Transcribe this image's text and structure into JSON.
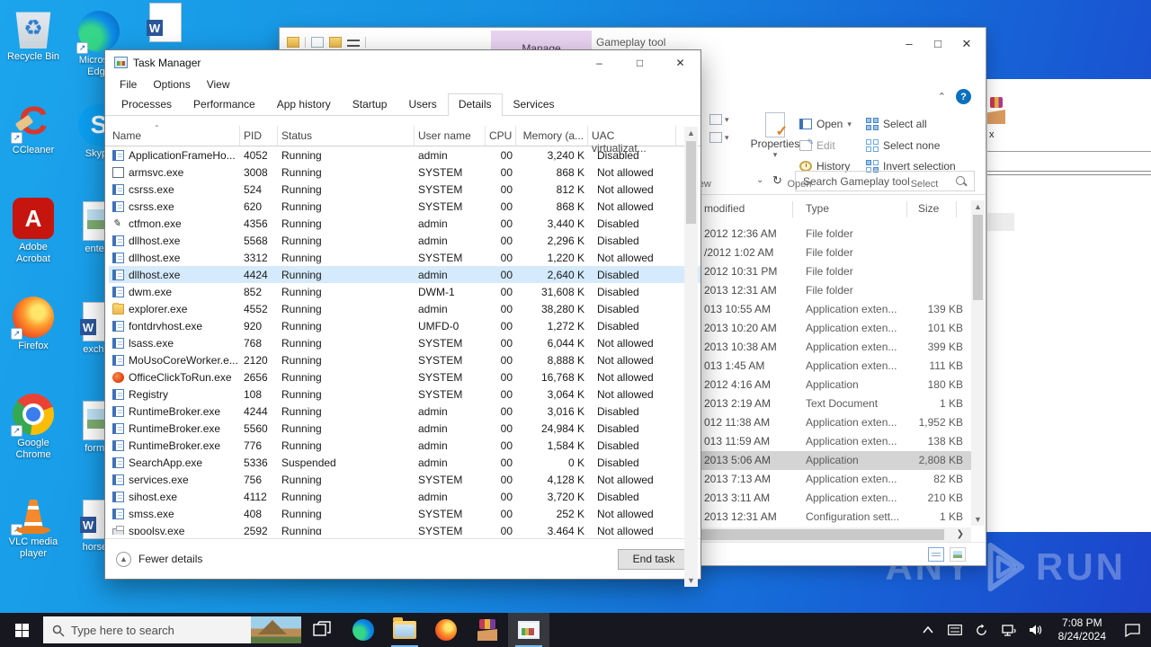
{
  "colors": {
    "desktop_top": "#1ba5ec",
    "desktop_bottom": "#1c43cb",
    "taskbar": "#17171f",
    "tm_selected_row": "#d5eafc",
    "fx_selected_row": "#d4d4d4",
    "manage_tab": "#e9d3f2",
    "help_blue": "#0b6fbd"
  },
  "desktop": {
    "col1": [
      {
        "label": "Recycle Bin",
        "icon": "recycle",
        "shortcut": false
      },
      {
        "label": "CCleaner",
        "icon": "ccleaner",
        "shortcut": true
      },
      {
        "label": "Adobe Acrobat",
        "icon": "acrobat",
        "shortcut": true
      },
      {
        "label": "Firefox",
        "icon": "firefox",
        "shortcut": true
      },
      {
        "label": "Google Chrome",
        "icon": "chrome",
        "shortcut": true
      },
      {
        "label": "VLC media player",
        "icon": "vlc",
        "shortcut": true
      }
    ],
    "col2": [
      {
        "label": "Microsoft Edge",
        "icon": "edge",
        "shortcut": true
      },
      {
        "label": "Skype",
        "icon": "skype",
        "shortcut": true
      },
      {
        "label": "enterb",
        "icon": "image-file",
        "shortcut": false
      },
      {
        "label": "exchan",
        "icon": "word-file",
        "shortcut": false
      },
      {
        "label": "former",
        "icon": "image-file",
        "shortcut": false
      },
      {
        "label": "horsem",
        "icon": "word-file",
        "shortcut": false
      }
    ],
    "top_icon": {
      "label": "",
      "icon": "word-file"
    }
  },
  "background_window": {
    "item_label": "x"
  },
  "explorer": {
    "title": "Gameplay tool",
    "manage_tab": "Manage",
    "ribbon": {
      "view_group_label": "View",
      "open_group_label": "Open",
      "select_group_label": "Select",
      "properties": "Properties",
      "open": "Open",
      "edit": "Edit",
      "history": "History",
      "select_all": "Select all",
      "select_none": "Select none",
      "invert_selection": "Invert selection"
    },
    "search_placeholder": "Search Gameplay tool",
    "columns": {
      "modified": "modified",
      "type": "Type",
      "size": "Size"
    },
    "files": [
      {
        "modified": "2012 12:36 AM",
        "type": "File folder",
        "size": "",
        "selected": false
      },
      {
        "modified": "/2012 1:02 AM",
        "type": "File folder",
        "size": "",
        "selected": false
      },
      {
        "modified": "2012 10:31 PM",
        "type": "File folder",
        "size": "",
        "selected": false
      },
      {
        "modified": "2013 12:31 AM",
        "type": "File folder",
        "size": "",
        "selected": false
      },
      {
        "modified": "013 10:55 AM",
        "type": "Application exten...",
        "size": "139 KB",
        "selected": false
      },
      {
        "modified": "2013 10:20 AM",
        "type": "Application exten...",
        "size": "101 KB",
        "selected": false
      },
      {
        "modified": "2013 10:38 AM",
        "type": "Application exten...",
        "size": "399 KB",
        "selected": false
      },
      {
        "modified": "013 1:45 AM",
        "type": "Application exten...",
        "size": "111 KB",
        "selected": false
      },
      {
        "modified": "2012 4:16 AM",
        "type": "Application",
        "size": "180 KB",
        "selected": false
      },
      {
        "modified": "2013 2:19 AM",
        "type": "Text Document",
        "size": "1 KB",
        "selected": false
      },
      {
        "modified": "012 11:38 AM",
        "type": "Application exten...",
        "size": "1,952 KB",
        "selected": false
      },
      {
        "modified": "013 11:59 AM",
        "type": "Application exten...",
        "size": "138 KB",
        "selected": false
      },
      {
        "modified": "2013 5:06 AM",
        "type": "Application",
        "size": "2,808 KB",
        "selected": true
      },
      {
        "modified": "2013 7:13 AM",
        "type": "Application exten...",
        "size": "82 KB",
        "selected": false
      },
      {
        "modified": "2013 3:11 AM",
        "type": "Application exten...",
        "size": "210 KB",
        "selected": false
      },
      {
        "modified": "2013 12:31 AM",
        "type": "Configuration sett...",
        "size": "1 KB",
        "selected": false
      }
    ]
  },
  "task_manager": {
    "title": "Task Manager",
    "menu": [
      "File",
      "Options",
      "View"
    ],
    "tabs": [
      {
        "label": "Processes",
        "active": false
      },
      {
        "label": "Performance",
        "active": false
      },
      {
        "label": "App history",
        "active": false
      },
      {
        "label": "Startup",
        "active": false
      },
      {
        "label": "Users",
        "active": false
      },
      {
        "label": "Details",
        "active": true
      },
      {
        "label": "Services",
        "active": false
      }
    ],
    "columns": [
      "Name",
      "PID",
      "Status",
      "User name",
      "CPU",
      "Memory (a...",
      "UAC virtualizat..."
    ],
    "processes": [
      {
        "name": "ApplicationFrameHo...",
        "icon": "app",
        "pid": "4052",
        "status": "Running",
        "user": "admin",
        "cpu": "00",
        "mem": "3,240 K",
        "uac": "Disabled",
        "selected": false
      },
      {
        "name": "armsvc.exe",
        "icon": "plain",
        "pid": "3008",
        "status": "Running",
        "user": "SYSTEM",
        "cpu": "00",
        "mem": "868 K",
        "uac": "Not allowed",
        "selected": false
      },
      {
        "name": "csrss.exe",
        "icon": "app",
        "pid": "524",
        "status": "Running",
        "user": "SYSTEM",
        "cpu": "00",
        "mem": "812 K",
        "uac": "Not allowed",
        "selected": false
      },
      {
        "name": "csrss.exe",
        "icon": "app",
        "pid": "620",
        "status": "Running",
        "user": "SYSTEM",
        "cpu": "00",
        "mem": "868 K",
        "uac": "Not allowed",
        "selected": false
      },
      {
        "name": "ctfmon.exe",
        "icon": "pen",
        "pid": "4356",
        "status": "Running",
        "user": "admin",
        "cpu": "00",
        "mem": "3,440 K",
        "uac": "Disabled",
        "selected": false
      },
      {
        "name": "dllhost.exe",
        "icon": "app",
        "pid": "5568",
        "status": "Running",
        "user": "admin",
        "cpu": "00",
        "mem": "2,296 K",
        "uac": "Disabled",
        "selected": false
      },
      {
        "name": "dllhost.exe",
        "icon": "app",
        "pid": "3312",
        "status": "Running",
        "user": "SYSTEM",
        "cpu": "00",
        "mem": "1,220 K",
        "uac": "Not allowed",
        "selected": false
      },
      {
        "name": "dllhost.exe",
        "icon": "app",
        "pid": "4424",
        "status": "Running",
        "user": "admin",
        "cpu": "00",
        "mem": "2,640 K",
        "uac": "Disabled",
        "selected": true
      },
      {
        "name": "dwm.exe",
        "icon": "app",
        "pid": "852",
        "status": "Running",
        "user": "DWM-1",
        "cpu": "00",
        "mem": "31,608 K",
        "uac": "Disabled",
        "selected": false
      },
      {
        "name": "explorer.exe",
        "icon": "folder",
        "pid": "4552",
        "status": "Running",
        "user": "admin",
        "cpu": "00",
        "mem": "38,280 K",
        "uac": "Disabled",
        "selected": false
      },
      {
        "name": "fontdrvhost.exe",
        "icon": "app",
        "pid": "920",
        "status": "Running",
        "user": "UMFD-0",
        "cpu": "00",
        "mem": "1,272 K",
        "uac": "Disabled",
        "selected": false
      },
      {
        "name": "lsass.exe",
        "icon": "app",
        "pid": "768",
        "status": "Running",
        "user": "SYSTEM",
        "cpu": "00",
        "mem": "6,044 K",
        "uac": "Not allowed",
        "selected": false
      },
      {
        "name": "MoUsoCoreWorker.e...",
        "icon": "app",
        "pid": "2120",
        "status": "Running",
        "user": "SYSTEM",
        "cpu": "00",
        "mem": "8,888 K",
        "uac": "Not allowed",
        "selected": false
      },
      {
        "name": "OfficeClickToRun.exe",
        "icon": "office",
        "pid": "2656",
        "status": "Running",
        "user": "SYSTEM",
        "cpu": "00",
        "mem": "16,768 K",
        "uac": "Not allowed",
        "selected": false
      },
      {
        "name": "Registry",
        "icon": "app",
        "pid": "108",
        "status": "Running",
        "user": "SYSTEM",
        "cpu": "00",
        "mem": "3,064 K",
        "uac": "Not allowed",
        "selected": false
      },
      {
        "name": "RuntimeBroker.exe",
        "icon": "app",
        "pid": "4244",
        "status": "Running",
        "user": "admin",
        "cpu": "00",
        "mem": "3,016 K",
        "uac": "Disabled",
        "selected": false
      },
      {
        "name": "RuntimeBroker.exe",
        "icon": "app",
        "pid": "5560",
        "status": "Running",
        "user": "admin",
        "cpu": "00",
        "mem": "24,984 K",
        "uac": "Disabled",
        "selected": false
      },
      {
        "name": "RuntimeBroker.exe",
        "icon": "app",
        "pid": "776",
        "status": "Running",
        "user": "admin",
        "cpu": "00",
        "mem": "1,584 K",
        "uac": "Disabled",
        "selected": false
      },
      {
        "name": "SearchApp.exe",
        "icon": "app",
        "pid": "5336",
        "status": "Suspended",
        "user": "admin",
        "cpu": "00",
        "mem": "0 K",
        "uac": "Disabled",
        "selected": false
      },
      {
        "name": "services.exe",
        "icon": "app",
        "pid": "756",
        "status": "Running",
        "user": "SYSTEM",
        "cpu": "00",
        "mem": "4,128 K",
        "uac": "Not allowed",
        "selected": false
      },
      {
        "name": "sihost.exe",
        "icon": "app",
        "pid": "4112",
        "status": "Running",
        "user": "admin",
        "cpu": "00",
        "mem": "3,720 K",
        "uac": "Disabled",
        "selected": false
      },
      {
        "name": "smss.exe",
        "icon": "app",
        "pid": "408",
        "status": "Running",
        "user": "SYSTEM",
        "cpu": "00",
        "mem": "252 K",
        "uac": "Not allowed",
        "selected": false
      },
      {
        "name": "spoolsv.exe",
        "icon": "printer",
        "pid": "2592",
        "status": "Running",
        "user": "SYSTEM",
        "cpu": "00",
        "mem": "3,464 K",
        "uac": "Not allowed",
        "selected": false
      }
    ],
    "footer": {
      "fewer_details": "Fewer details",
      "end_task": "End task"
    }
  },
  "taskbar": {
    "search_placeholder": "Type here to search",
    "apps": [
      {
        "name": "edge",
        "open": false,
        "focused": false
      },
      {
        "name": "explorer",
        "open": true,
        "focused": false
      },
      {
        "name": "firefox",
        "open": false,
        "focused": false
      },
      {
        "name": "winrar",
        "open": false,
        "focused": false
      },
      {
        "name": "task-manager",
        "open": true,
        "focused": true
      }
    ],
    "clock": {
      "time": "7:08 PM",
      "date": "8/24/2024"
    }
  },
  "watermark": {
    "left": "ANY",
    "right": "RUN"
  }
}
